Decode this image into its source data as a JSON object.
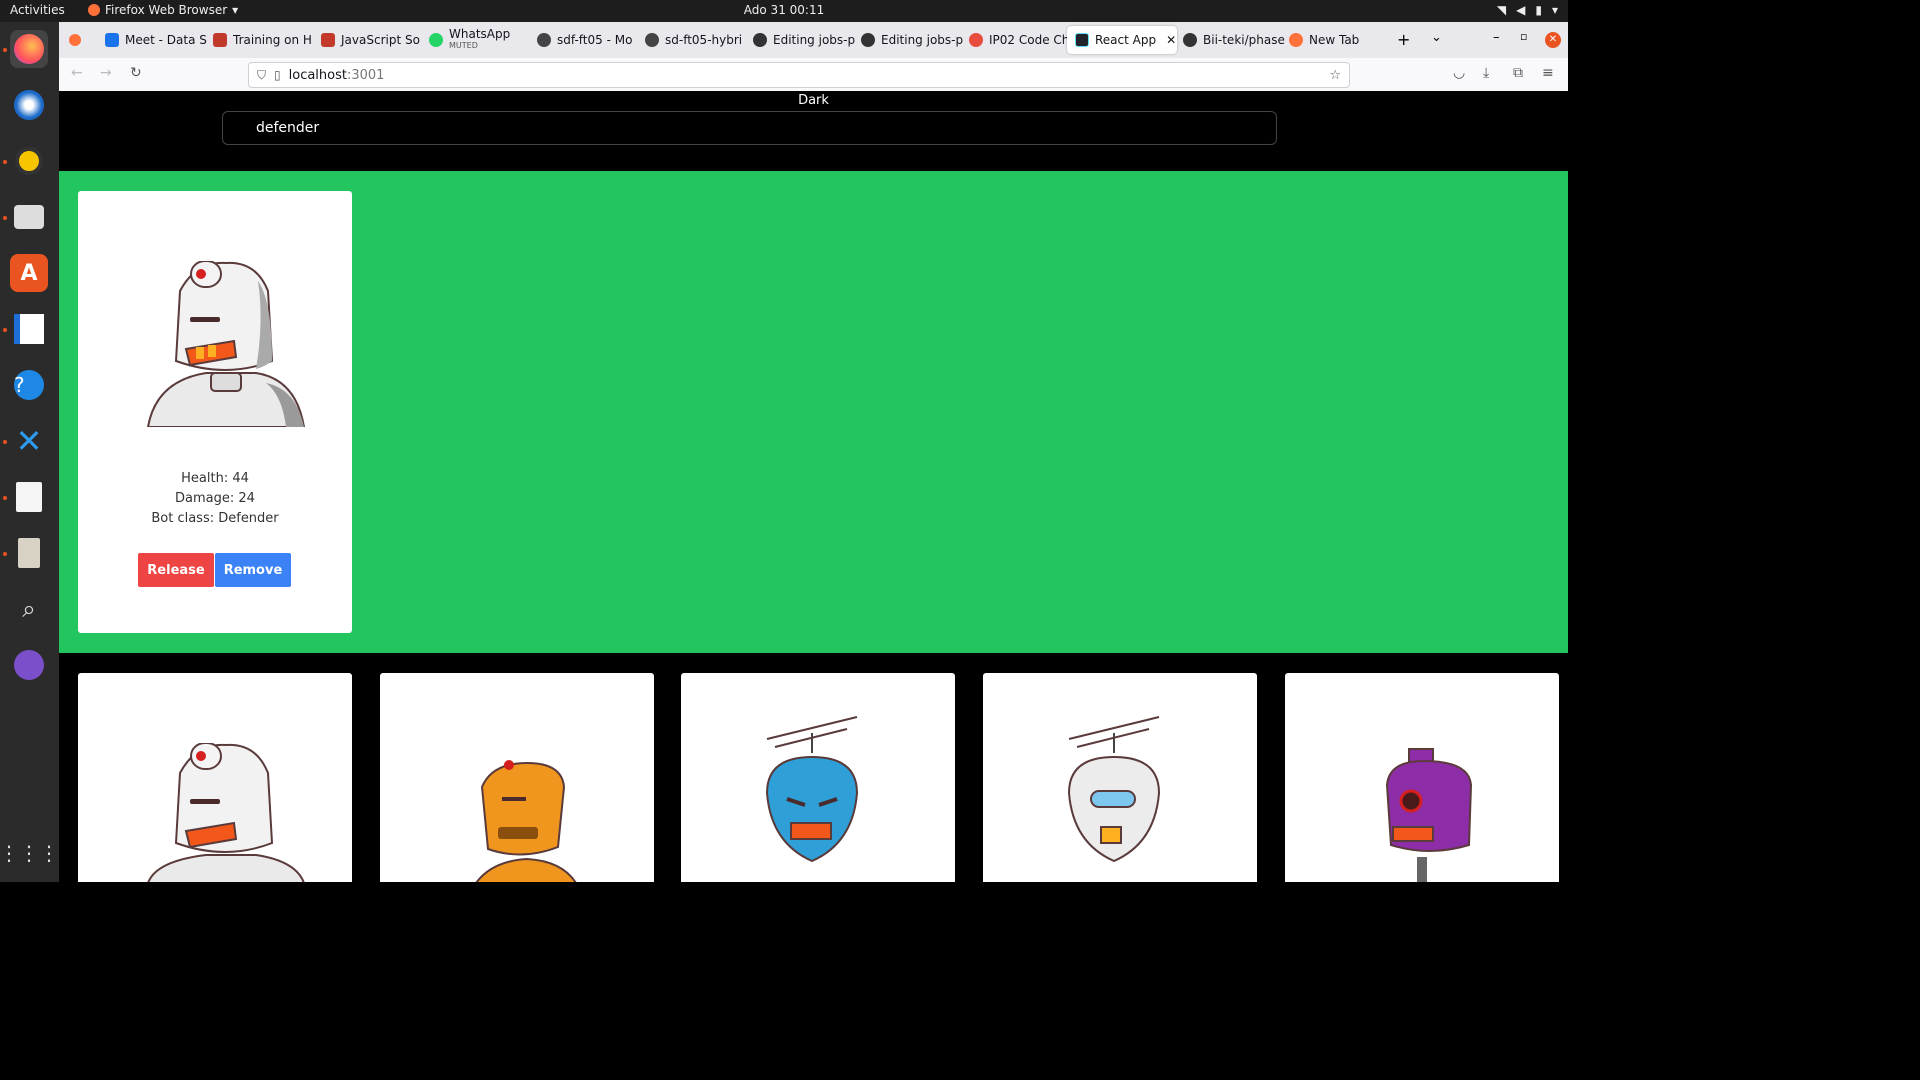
{
  "topbar": {
    "activities": "Activities",
    "app_name": "Firefox Web Browser",
    "clock": "Ado 31  00:11"
  },
  "tabs": [
    {
      "label": "Meet - Data S",
      "color": "#1a73e8"
    },
    {
      "label": "Training on H",
      "color": "#c0392b"
    },
    {
      "label": "JavaScript So",
      "color": "#c0392b"
    },
    {
      "label": "WhatsApp",
      "sub": "MUTED",
      "color": "#25d366"
    },
    {
      "label": "sdf-ft05 - Mo",
      "color": "#444"
    },
    {
      "label": "sd-ft05-hybri",
      "color": "#444"
    },
    {
      "label": "Editing jobs-p",
      "color": "#333"
    },
    {
      "label": "Editing jobs-p",
      "color": "#333"
    },
    {
      "label": "IP02 Code Ch",
      "color": "#e74c3c"
    },
    {
      "label": "React App",
      "color": "#61dafb"
    },
    {
      "label": "Bii-teki/phase",
      "color": "#333"
    },
    {
      "label": "New Tab",
      "color": "#ff7139"
    }
  ],
  "url": {
    "host": "localhost",
    "port": ":3001"
  },
  "page": {
    "theme_label": "Dark",
    "search_value": "defender",
    "army": [
      {
        "health": "Health: 44",
        "damage": "Damage: 24",
        "bot_class": "Bot class: Defender",
        "release_label": "Release",
        "remove_label": "Remove",
        "color": "#e8e8e8",
        "robot": "white-robot"
      }
    ],
    "collection": [
      {
        "color": "#e8e8e8",
        "robot": "white-robot"
      },
      {
        "color": "#f0961e",
        "robot": "orange-robot"
      },
      {
        "color": "#2f9fd8",
        "robot": "blue-robot"
      },
      {
        "color": "#ececec",
        "robot": "silver-robot"
      },
      {
        "color": "#8e2da8",
        "robot": "purple-robot"
      }
    ]
  },
  "colors": {
    "army_bg": "#22c55e",
    "release_btn": "#ef4444",
    "remove_btn": "#3b82f6"
  }
}
